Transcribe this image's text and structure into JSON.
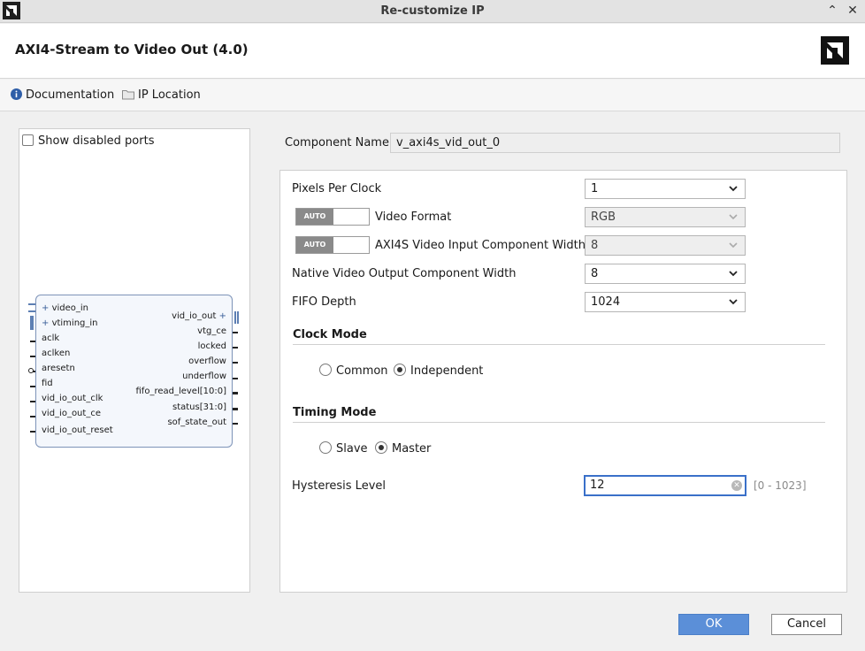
{
  "window": {
    "title": "Re-customize IP",
    "minimize_glyph": "⌃",
    "close_glyph": "✕"
  },
  "header": {
    "ip_title": "AXI4-Stream to Video Out (4.0)"
  },
  "docbar": {
    "documentation": "Documentation",
    "ip_location": "IP Location"
  },
  "left": {
    "show_disabled_ports": "Show disabled ports",
    "inputs": [
      "video_in",
      "vtiming_in",
      "aclk",
      "aclken",
      "aresetn",
      "fid",
      "vid_io_out_clk",
      "vid_io_out_ce",
      "vid_io_out_reset"
    ],
    "outputs": [
      "vid_io_out",
      "vtg_ce",
      "locked",
      "overflow",
      "underflow",
      "fifo_read_level[10:0]",
      "status[31:0]",
      "sof_state_out"
    ]
  },
  "form": {
    "component_name_label": "Component Name",
    "component_name_value": "v_axi4s_vid_out_0",
    "auto_label": "AUTO",
    "pixels_per_clock_label": "Pixels Per Clock",
    "pixels_per_clock_value": "1",
    "video_format_label": "Video Format",
    "video_format_value": "RGB",
    "axi4s_width_label": "AXI4S Video Input Component Width",
    "axi4s_width_value": "8",
    "native_width_label": "Native Video Output Component Width",
    "native_width_value": "8",
    "fifo_depth_label": "FIFO Depth",
    "fifo_depth_value": "1024",
    "clock_mode_title": "Clock Mode",
    "clock_common": "Common",
    "clock_independent": "Independent",
    "timing_mode_title": "Timing Mode",
    "timing_slave": "Slave",
    "timing_master": "Master",
    "hysteresis_label": "Hysteresis Level",
    "hysteresis_value": "12",
    "hysteresis_range": "[0 - 1023]"
  },
  "buttons": {
    "ok": "OK",
    "cancel": "Cancel"
  },
  "colors": {
    "primary_button": "#5b8fd8",
    "focus_border": "#3a70c9"
  }
}
